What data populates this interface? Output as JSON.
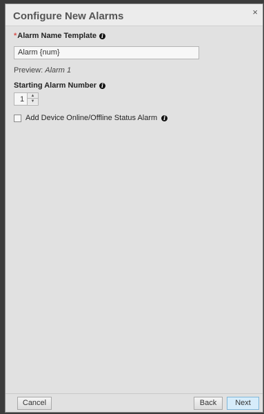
{
  "dialog": {
    "title": "Configure New Alarms",
    "close_icon": "×"
  },
  "form": {
    "name_template": {
      "required_marker": "*",
      "label": "Alarm Name Template",
      "value": "Alarm {num}"
    },
    "preview": {
      "label": "Preview: ",
      "value": "Alarm 1"
    },
    "starting_number": {
      "label": "Starting Alarm Number",
      "value": "1",
      "up_glyph": "▲",
      "down_glyph": "▼"
    },
    "status_alarm": {
      "label": "Add Device Online/Offline Status Alarm",
      "checked": false
    },
    "info_glyph": "i"
  },
  "footer": {
    "cancel_label": "Cancel",
    "back_label": "Back",
    "next_label": "Next"
  }
}
